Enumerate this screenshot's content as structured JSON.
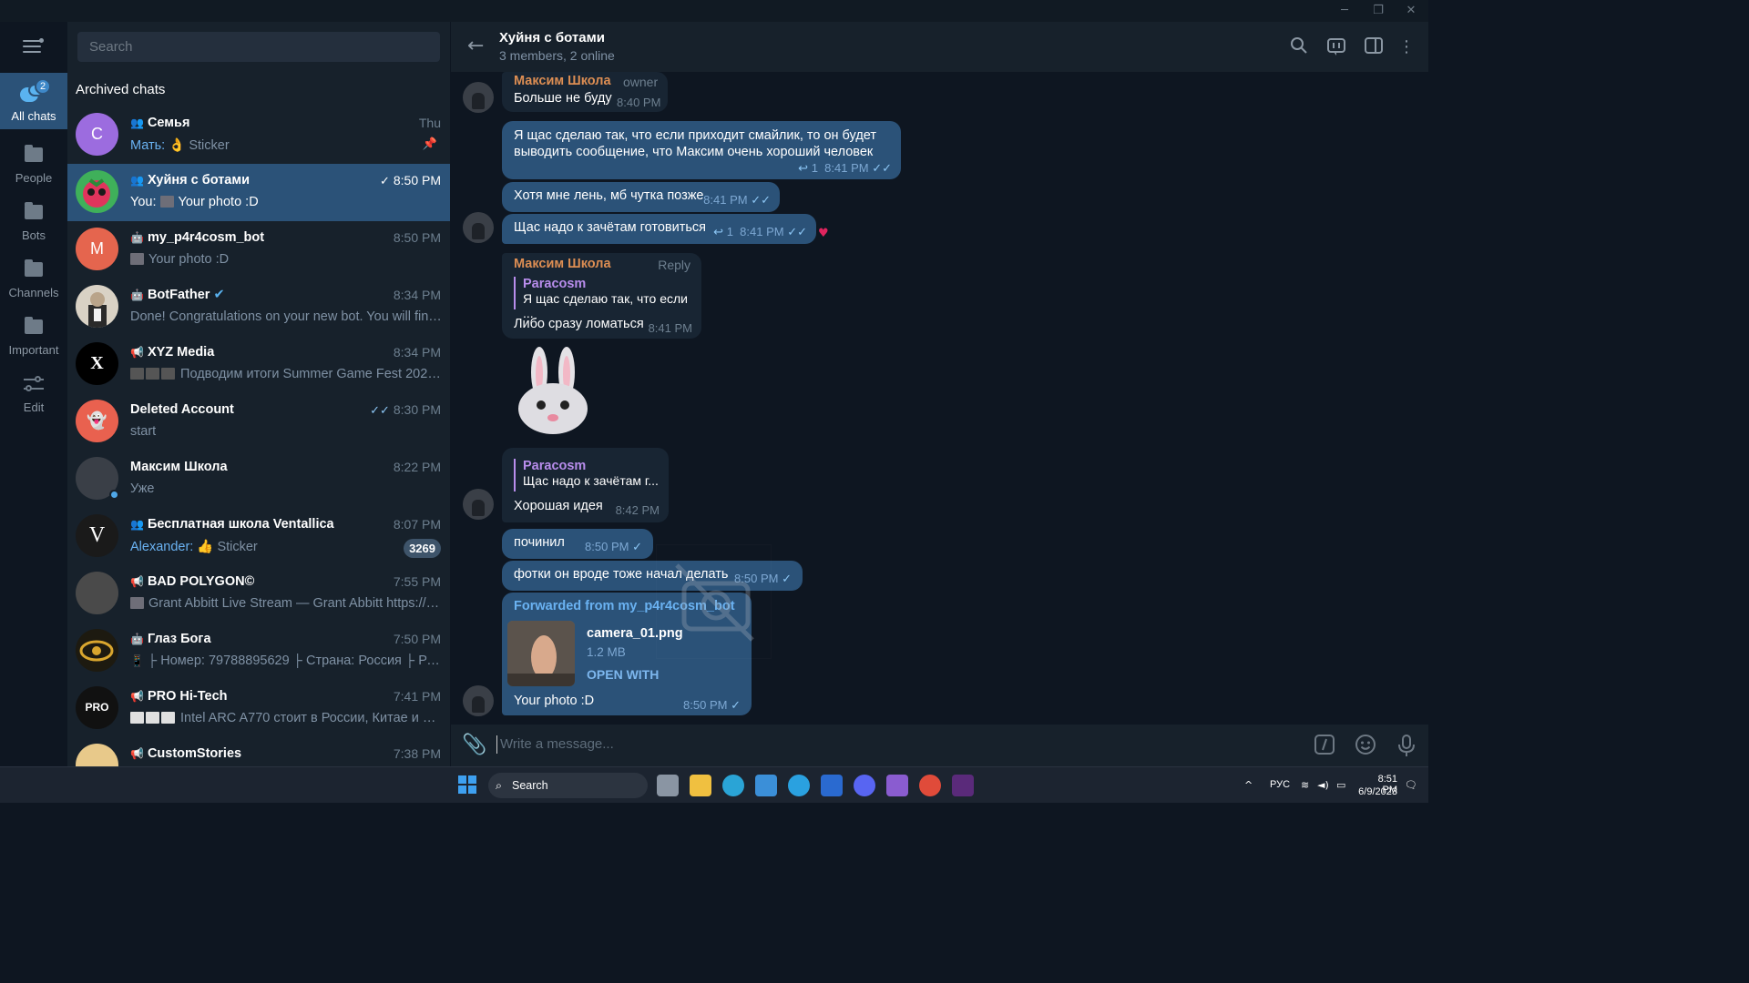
{
  "window": {
    "minimize_icon": "minimize-icon",
    "restore_icon": "restore-icon",
    "close_icon": "close-icon"
  },
  "folders": [
    {
      "label": "All chats",
      "badge": "2",
      "active": true
    },
    {
      "label": "People"
    },
    {
      "label": "Bots"
    },
    {
      "label": "Channels"
    },
    {
      "label": "Important"
    },
    {
      "label": "Edit"
    }
  ],
  "search": {
    "placeholder": "Search"
  },
  "archived_label": "Archived chats",
  "chats": [
    {
      "name": "Семья",
      "time": "Thu",
      "sender": "Мать:",
      "preview": "👌 Sticker",
      "avatar_letter": "С",
      "avatar_color": "#9c6cdf",
      "type": "group",
      "pinned": true
    },
    {
      "name": "Хуйня с ботами",
      "time": "8:50 PM",
      "sender": "You:",
      "preview": "Your photo :D",
      "type": "group",
      "selected": true,
      "status": "✓"
    },
    {
      "name": "my_p4r4cosm_bot",
      "time": "8:50 PM",
      "preview": "Your photo :D",
      "avatar_letter": "M",
      "avatar_color": "#e5654e",
      "type": "bot"
    },
    {
      "name": "BotFather",
      "time": "8:34 PM",
      "preview": "Done! Congratulations on your new bot. You will find i...",
      "type": "bot",
      "verified": true
    },
    {
      "name": "XYZ Media",
      "time": "8:34 PM",
      "preview": "Подводим итоги Summer Game Fest 2023. ...",
      "type": "channel"
    },
    {
      "name": "Deleted Account",
      "time": "8:30 PM",
      "preview": "start",
      "status": "✓✓"
    },
    {
      "name": "Максим Школа",
      "time": "8:22 PM",
      "preview": "Уже",
      "online": true
    },
    {
      "name": "Бесплатная школа Ventallica",
      "time": "8:07 PM",
      "sender": "Alexander:",
      "preview": "👍 Sticker",
      "badge": "3269",
      "type": "group"
    },
    {
      "name": "BAD POLYGON©",
      "time": "7:55 PM",
      "preview": "Grant Abbitt Live Stream — Grant Abbitt https://y...",
      "type": "channel"
    },
    {
      "name": "Глаз Бога",
      "time": "7:50 PM",
      "preview": "├ Номер: 79788895629 ├ Страна: Россия ├ Регио...",
      "type": "bot"
    },
    {
      "name": "PRO Hi-Tech",
      "time": "7:41 PM",
      "preview": "Intel ARC A770 стоит в России, Китае и ряде...",
      "type": "channel"
    },
    {
      "name": "CustomStories",
      "time": "7:38 PM",
      "preview": "",
      "type": "channel"
    }
  ],
  "header": {
    "title": "Хуйня с ботами",
    "subtitle": "3 members, 2 online"
  },
  "messages": {
    "m1": {
      "sender": "Максим Школа",
      "role": "owner",
      "text": "Больше не буду",
      "time": "8:40 PM"
    },
    "m2": {
      "text": "Я щас сделаю так, что если приходит смайлик, то он будет выводить сообщение, что Максим очень хороший человек",
      "replies": "1",
      "time": "8:41 PM"
    },
    "m3": {
      "text": "Хотя мне лень, мб чутка позже",
      "time": "8:41 PM"
    },
    "m4": {
      "text": "Щас надо к зачётам готовиться",
      "replies": "1",
      "time": "8:41 PM",
      "reaction": "❤️"
    },
    "m5": {
      "sender": "Максим Школа",
      "reply_label": "Reply",
      "quote_name": "Paracosm",
      "quote_text": "Я щас сделаю так, что если ...",
      "text": "Либо сразу ломаться",
      "time": "8:41 PM"
    },
    "sticker": "🐰",
    "m6": {
      "quote_name": "Paracosm",
      "quote_text": "Щас надо к зачётам г...",
      "text": "Хорошая идея",
      "time": "8:42 PM"
    },
    "m7": {
      "text": "починил",
      "time": "8:50 PM"
    },
    "m8": {
      "text": "фотки он вроде тоже начал делать",
      "time": "8:50 PM"
    },
    "m9": {
      "forwarded": "Forwarded from my_p4r4cosm_bot",
      "file_name": "camera_01.png",
      "file_size": "1.2 MB",
      "open_with": "OPEN WITH",
      "text": "Your photo :D",
      "time": "8:50 PM"
    }
  },
  "input": {
    "placeholder": "Write a message..."
  },
  "taskbar": {
    "search": "Search",
    "lang": "РУС",
    "time": "8:51 PM",
    "date": "6/9/2023"
  }
}
